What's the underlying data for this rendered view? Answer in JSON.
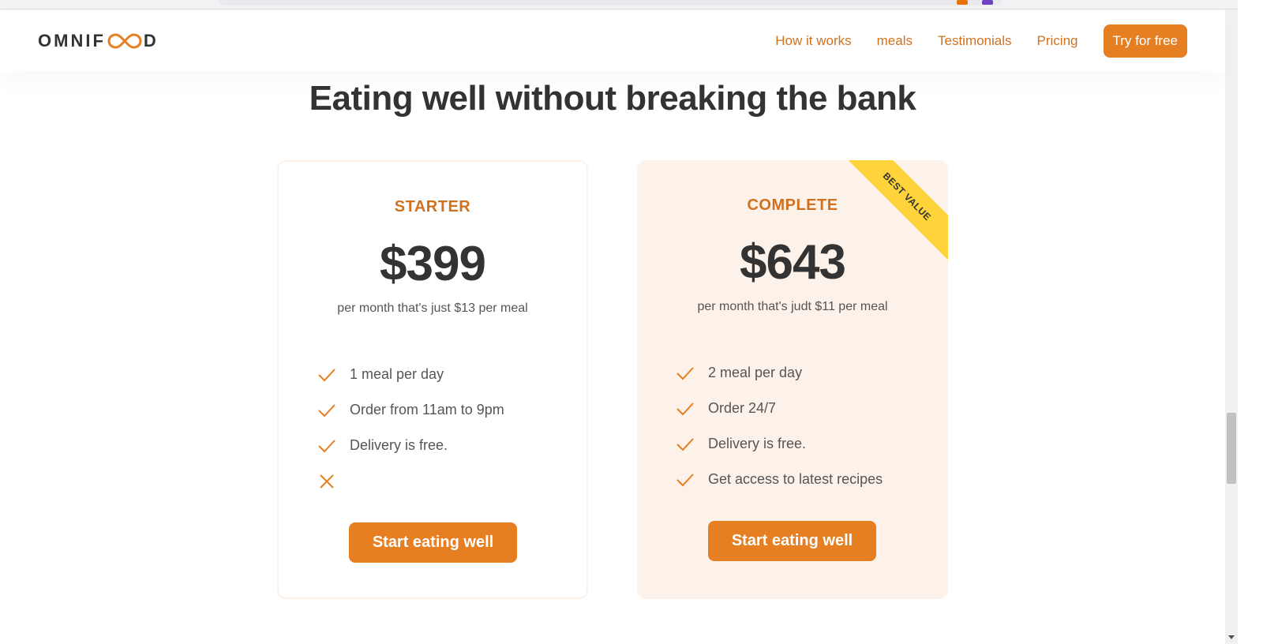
{
  "header": {
    "logo_text_left": "OMNIF",
    "logo_text_right": "D",
    "nav": [
      {
        "label": "How it works"
      },
      {
        "label": "meals"
      },
      {
        "label": "Testimonials"
      },
      {
        "label": "Pricing"
      }
    ],
    "cta_label": "Try for free"
  },
  "section": {
    "title": "Eating well without breaking the bank"
  },
  "plans": [
    {
      "name": "STARTER",
      "price": "$399",
      "description": "per month that's just $13 per meal",
      "features": [
        {
          "text": "1 meal per day",
          "icon": "check-icon"
        },
        {
          "text": "Order from 11am to 9pm",
          "icon": "check-icon"
        },
        {
          "text": "Delivery is free.",
          "icon": "check-icon"
        },
        {
          "text": "",
          "icon": "close-icon"
        }
      ],
      "button_label": "Start eating well"
    },
    {
      "name": "COMPLETE",
      "price": "$643",
      "description": "per month that's judt $11 per meal",
      "ribbon": "BEST VALUE",
      "features": [
        {
          "text": "2 meal per day",
          "icon": "check-icon"
        },
        {
          "text": "Order 24/7",
          "icon": "check-icon"
        },
        {
          "text": "Delivery is free.",
          "icon": "check-icon"
        },
        {
          "text": "Get access to latest recipes",
          "icon": "check-icon"
        }
      ],
      "button_label": "Start eating well"
    }
  ],
  "colors": {
    "accent": "#e67e22",
    "accent_text": "#cf711f",
    "card_tint": "#fdf2e9",
    "ribbon": "#ffd43b",
    "heading": "#333333"
  }
}
